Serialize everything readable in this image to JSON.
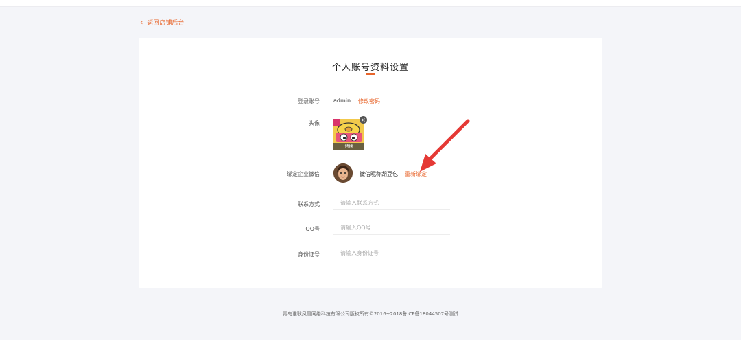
{
  "nav": {
    "back_label": "返回店铺后台"
  },
  "page": {
    "title": "个人账号资料设置"
  },
  "form": {
    "login_label": "登录账号",
    "login_value": "admin",
    "change_password_label": "修改密码",
    "avatar_label": "头像",
    "avatar_replace_label": "替换",
    "wechat_label": "绑定企业微信",
    "wechat_nickname": "微信昵称胡豆包",
    "rebind_label": "重新绑定",
    "contact_label": "联系方式",
    "contact_placeholder": "请输入联系方式",
    "qq_label": "QQ号",
    "qq_placeholder": "请输入QQ号",
    "id_label": "身份证号",
    "id_placeholder": "请输入身份证号"
  },
  "footer": {
    "copyright": "青岛谁耿凤凰网络科技有限公司版权所有©2016~2018鲁ICP备18044507号测试"
  },
  "colors": {
    "accent": "#e8662c",
    "background": "#f4f5f9",
    "card": "#ffffff",
    "annotation_arrow": "#e53935"
  }
}
